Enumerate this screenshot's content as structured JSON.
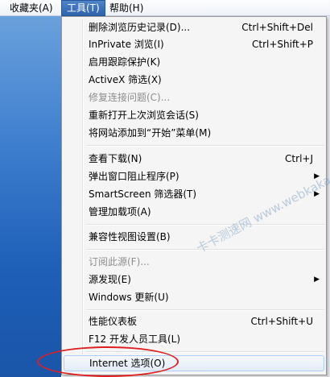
{
  "menubar": {
    "items": [
      "收藏夹(A)",
      "工具(T)",
      "帮助(H)"
    ]
  },
  "tools_menu": {
    "items": [
      {
        "label": "删除浏览历史记录(D)...",
        "shortcut": "Ctrl+Shift+Del",
        "disabled": false
      },
      {
        "label": "InPrivate 浏览(I)",
        "shortcut": "Ctrl+Shift+P",
        "disabled": false
      },
      {
        "label": "启用跟踪保护(K)",
        "shortcut": "",
        "disabled": false
      },
      {
        "label": "ActiveX 筛选(X)",
        "shortcut": "",
        "disabled": false
      },
      {
        "label": "修复连接问题(C)...",
        "shortcut": "",
        "disabled": true
      },
      {
        "label": "重新打开上次浏览会话(S)",
        "shortcut": "",
        "disabled": false
      },
      {
        "label": "将网站添加到“开始”菜单(M)",
        "shortcut": "",
        "disabled": false
      },
      {
        "label": "查看下载(N)",
        "shortcut": "Ctrl+J",
        "disabled": false
      },
      {
        "label": "弹出窗口阻止程序(P)",
        "shortcut": "",
        "submenu": true,
        "disabled": false
      },
      {
        "label": "SmartScreen 筛选器(T)",
        "shortcut": "",
        "submenu": true,
        "disabled": false
      },
      {
        "label": "管理加载项(A)",
        "shortcut": "",
        "disabled": false
      },
      {
        "label": "兼容性视图设置(B)",
        "shortcut": "",
        "disabled": false
      },
      {
        "label": "订阅此源(F)...",
        "shortcut": "",
        "disabled": true
      },
      {
        "label": "源发现(E)",
        "shortcut": "",
        "submenu": true,
        "disabled": false
      },
      {
        "label": "Windows 更新(U)",
        "shortcut": "",
        "disabled": false
      },
      {
        "label": "性能仪表板",
        "shortcut": "Ctrl+Shift+U",
        "disabled": false
      },
      {
        "label": "F12 开发人员工具(L)",
        "shortcut": "",
        "disabled": false
      },
      {
        "label": "Internet 选项(O)",
        "shortcut": "",
        "disabled": false
      }
    ],
    "submenu_arrow": "▶"
  },
  "watermark": "卡卡测速网 www.webkaka.com",
  "colors": {
    "highlight_border": "#aecff7",
    "annotation": "#e02020",
    "page_blue": "#3f7fcf"
  }
}
